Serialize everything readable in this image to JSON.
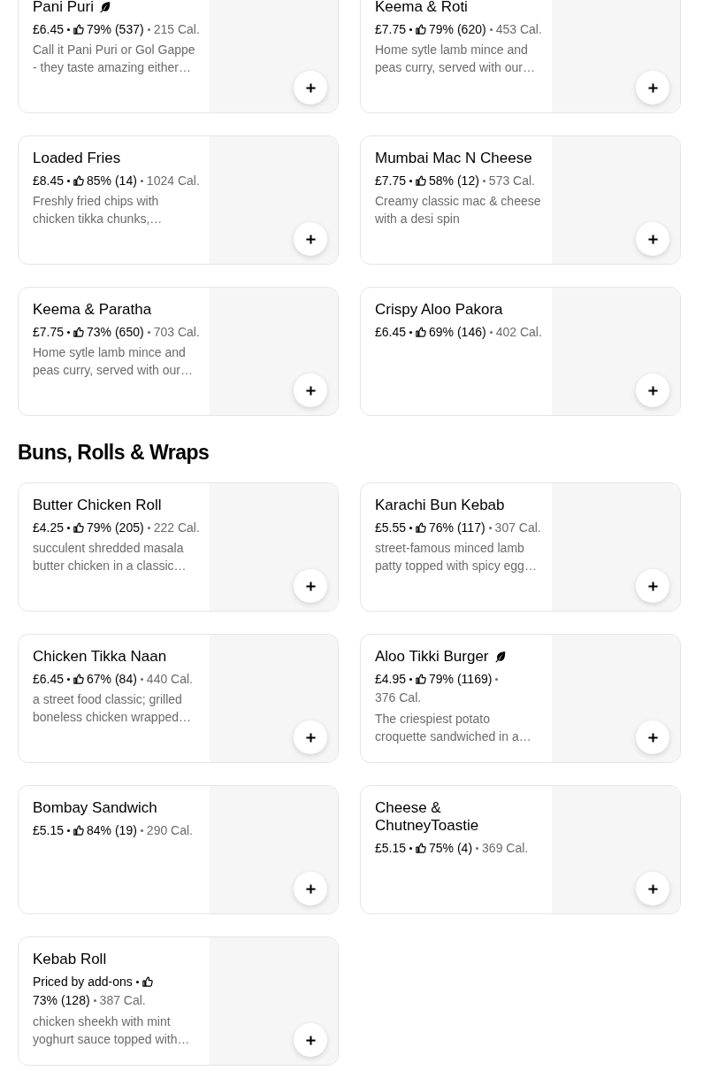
{
  "sections": [
    {
      "items": [
        {
          "name": "Pani Puri",
          "vegetarian": true,
          "price": "£6.45",
          "rating": "79% (537)",
          "calories": "215 Cal.",
          "description": "Call it Pani Puri or Gol Gappe - they taste amazing either…"
        },
        {
          "name": "Keema & Roti",
          "vegetarian": false,
          "price": "£7.75",
          "rating": "79% (620)",
          "calories": "453 Cal.",
          "description": "Home sytle lamb mince and peas curry, served with our…"
        },
        {
          "name": "Loaded Fries",
          "vegetarian": false,
          "price": "£8.45",
          "rating": "85% (14)",
          "calories": "1024 Cal.",
          "description": "Freshly fried chips with chicken tikka chunks,…"
        },
        {
          "name": "Mumbai Mac N Cheese",
          "vegetarian": false,
          "price": "£7.75",
          "rating": "58% (12)",
          "calories": "573 Cal.",
          "description": "Creamy classic mac & cheese with a desi spin"
        },
        {
          "name": "Keema & Paratha",
          "vegetarian": false,
          "price": "£7.75",
          "rating": "73% (650)",
          "calories": "703 Cal.",
          "description": "Home sytle lamb mince and peas curry, served with our…"
        },
        {
          "name": "Crispy Aloo Pakora",
          "vegetarian": false,
          "price": "£6.45",
          "rating": "69% (146)",
          "calories": "402 Cal."
        }
      ]
    },
    {
      "title": "Buns, Rolls & Wraps",
      "items": [
        {
          "name": "Butter Chicken Roll",
          "vegetarian": false,
          "price": "£4.25",
          "rating": "79% (205)",
          "calories": "222 Cal.",
          "description": "succulent shredded masala butter chicken in a classic…"
        },
        {
          "name": "Karachi Bun Kebab",
          "vegetarian": false,
          "price": "£5.55",
          "rating": "76% (117)",
          "calories": "307 Cal.",
          "description": "street-famous minced lamb patty topped with spicy egg…"
        },
        {
          "name": "Chicken Tikka Naan",
          "vegetarian": false,
          "price": "£6.45",
          "rating": "67% (84)",
          "calories": "440 Cal.",
          "description": "a street food classic; grilled boneless chicken wrapped…"
        },
        {
          "name": "Aloo Tikki Burger",
          "vegetarian": true,
          "price": "£4.95",
          "rating": "79% (1169)",
          "calories": "376 Cal.",
          "description": "The criespiest potato croquette sandwiched in a…"
        },
        {
          "name": "Bombay Sandwich",
          "vegetarian": false,
          "price": "£5.15",
          "rating": "84% (19)",
          "calories": "290 Cal."
        },
        {
          "name": "Cheese & ChutneyToastie",
          "vegetarian": false,
          "price": "£5.15",
          "rating": "75% (4)",
          "calories": "369 Cal."
        },
        {
          "name": "Kebab Roll",
          "vegetarian": false,
          "price": "Priced by add-ons",
          "rating": "73% (128)",
          "calories": "387 Cal.",
          "description": "chicken sheekh with mint yoghurt sauce topped with…"
        }
      ]
    }
  ]
}
